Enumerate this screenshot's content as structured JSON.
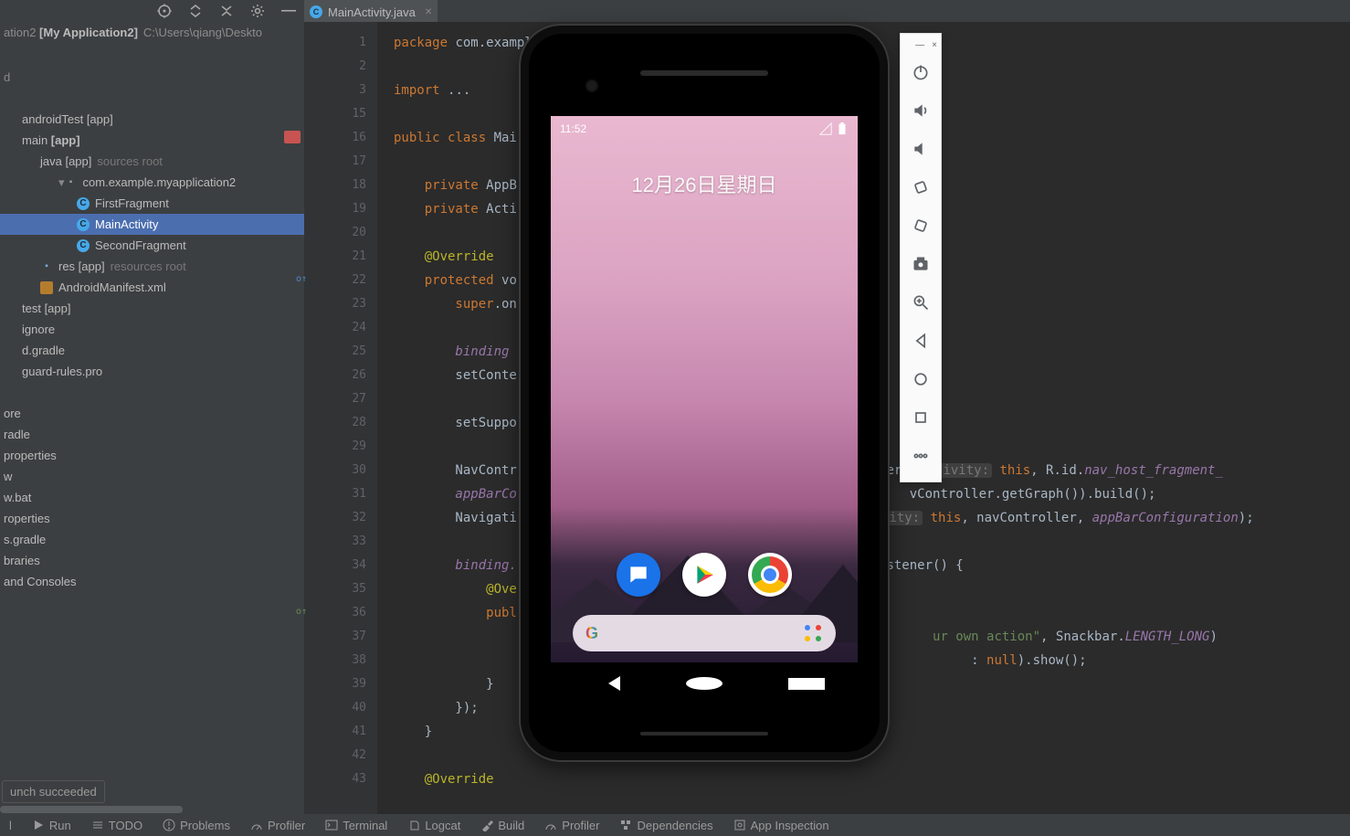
{
  "breadcrumb": {
    "suffix": "ation2",
    "project": "[My Application2]",
    "path": "C:\\Users\\qiang\\Deskto"
  },
  "tabs": [
    {
      "label": "MainActivity.java"
    }
  ],
  "toolbar_icons": [
    "target-icon",
    "step-down-icon",
    "step-up-icon",
    "gear-icon",
    "minimize-icon"
  ],
  "tree": [
    {
      "text": "",
      "indent": 0
    },
    {
      "text": "d",
      "indent": 0,
      "muted": true
    },
    {
      "text": "",
      "indent": 0
    },
    {
      "text": "androidTest [app]",
      "indent": 2
    },
    {
      "text": "main [app]",
      "indent": 2,
      "bold": true
    },
    {
      "text": "java [app]",
      "indent": 4,
      "hint": "sources root"
    },
    {
      "text": "com.example.myapplication2",
      "indent": 6,
      "icon": "pkg",
      "chev": true
    },
    {
      "text": "FirstFragment",
      "indent": 8,
      "icon": "java"
    },
    {
      "text": "MainActivity",
      "indent": 8,
      "icon": "java",
      "sel": true
    },
    {
      "text": "SecondFragment",
      "indent": 8,
      "icon": "java"
    },
    {
      "text": "res [app]",
      "indent": 4,
      "hint": "resources root",
      "icon": "folder"
    },
    {
      "text": "AndroidManifest.xml",
      "indent": 4,
      "icon": "xml"
    },
    {
      "text": "test [app]",
      "indent": 2
    },
    {
      "text": "ignore",
      "indent": 2
    },
    {
      "text": "d.gradle",
      "indent": 2
    },
    {
      "text": "guard-rules.pro",
      "indent": 2
    },
    {
      "text": "",
      "indent": 0
    },
    {
      "text": "ore",
      "indent": 0
    },
    {
      "text": "radle",
      "indent": 0
    },
    {
      "text": "properties",
      "indent": 0
    },
    {
      "text": "w",
      "indent": 0
    },
    {
      "text": "w.bat",
      "indent": 0
    },
    {
      "text": "roperties",
      "indent": 0
    },
    {
      "text": "s.gradle",
      "indent": 0
    },
    {
      "text": "braries",
      "indent": 0
    },
    {
      "text": "and Consoles",
      "indent": 0
    }
  ],
  "status_bubble": "unch succeeded",
  "bottom": [
    {
      "label": "l"
    },
    {
      "label": "Run",
      "icon": "play-icon"
    },
    {
      "label": "TODO",
      "icon": "list-icon"
    },
    {
      "label": "Problems",
      "icon": "warn-icon"
    },
    {
      "label": "Profiler",
      "icon": "meter-icon"
    },
    {
      "label": "Terminal",
      "icon": "terminal-icon"
    },
    {
      "label": "Logcat",
      "icon": "logcat-icon"
    },
    {
      "label": "Build",
      "icon": "hammer-icon"
    },
    {
      "label": "Profiler",
      "icon": "meter-icon"
    },
    {
      "label": "Dependencies",
      "icon": "deps-icon"
    },
    {
      "label": "App Inspection",
      "icon": "inspect-icon"
    }
  ],
  "gutter": {
    "numbers": [
      1,
      2,
      3,
      15,
      16,
      17,
      18,
      19,
      20,
      21,
      22,
      23,
      24,
      25,
      26,
      27,
      28,
      29,
      30,
      31,
      32,
      33,
      34,
      35,
      36,
      37,
      38,
      39,
      40,
      41,
      42,
      43
    ],
    "markers": {
      "16": "break",
      "22": "ovr-up",
      "36": "ovr-up-green"
    }
  },
  "code": {
    "l1": {
      "kw": "package ",
      "rest": "com.example"
    },
    "l3": {
      "kw": "import ",
      "dots": "..."
    },
    "l16": {
      "kw": "public class ",
      "name": "Mai"
    },
    "l18": {
      "kw": "    private ",
      "type": "AppB"
    },
    "l19": {
      "kw": "    private ",
      "type": "Acti"
    },
    "l21": "    @Override",
    "l22": {
      "kw": "    protected ",
      "type": "vo"
    },
    "l23": {
      "s": "        super",
      "rest": ".on"
    },
    "l25": {
      "mem": "        binding "
    },
    "l26": "        setConte",
    "l28": "        setSuppo",
    "l30_a": "        NavContr",
    "l30_b": "er(",
    "l30_h": "activity:",
    "l30_c": " this, R.id.",
    "l30_m": "nav_host_fragment_",
    "l31_a": "        appBarCo",
    "l31_b": "vController.getGraph()).build();",
    "l32_a": "        Navigati",
    "l32_h": "vity:",
    "l32_b": " this, navController, ",
    "l32_m": "appBarConfiguration",
    "l32_c": ");",
    "l34_a": "        binding.",
    "l34_b": "istener() {",
    "l35": "            @Ove",
    "l36": {
      "kw": "            publ"
    },
    "l37_a": "ur own action\"",
    "l37_b": ", Snackbar.",
    "l37_m": "LENGTH_LONG",
    "l37_c": ")",
    "l38_a": ": ",
    "l38_h": "null",
    "l38_b": ").show();",
    "l39": "            }",
    "l40": "        });",
    "l41": "    }",
    "l43": "    @Override"
  },
  "emulator": {
    "status_time": "11:52",
    "date": "12月26日星期日",
    "apps": [
      "messages",
      "play",
      "chrome"
    ],
    "toolbar": [
      "power",
      "volume-up",
      "volume-down",
      "rotate-left",
      "rotate-right",
      "camera",
      "zoom",
      "back",
      "home",
      "overview",
      "more"
    ],
    "titlebar": {
      "min": "—",
      "close": "×"
    }
  }
}
